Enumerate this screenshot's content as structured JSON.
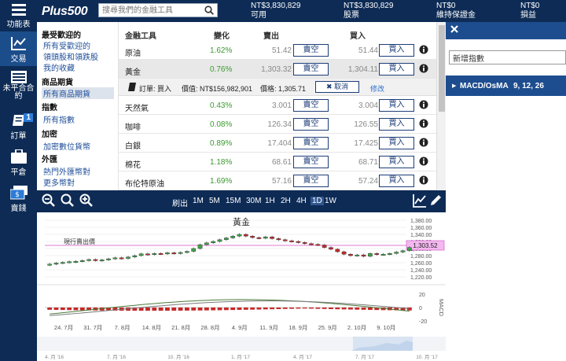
{
  "nav": {
    "items": [
      {
        "label": "功能表",
        "icon": "hamburger-menu-icon"
      },
      {
        "label": "交易",
        "icon": "trade-chart-icon"
      },
      {
        "label": "未平合合約",
        "icon": "positions-list-icon"
      },
      {
        "label": "訂單",
        "icon": "orders-notebook-icon",
        "badge": "1"
      },
      {
        "label": "平倉",
        "icon": "briefcase-icon"
      },
      {
        "label": "賣錢",
        "icon": "funds-money-icon"
      }
    ]
  },
  "header": {
    "logo": "Plus500",
    "search_placeholder": "搜尋我們的金融工具",
    "stats": [
      {
        "value": "NT$3,830,829",
        "label": "可用"
      },
      {
        "value": "NT$3,830,829",
        "label": "股票"
      },
      {
        "value": "NT$0",
        "label": "維持保證金"
      },
      {
        "value": "NT$0",
        "label": "損益"
      }
    ]
  },
  "sidebar": {
    "groups": [
      {
        "heading": "最受歡迎的",
        "items": [
          "所有受歡迎的",
          "領頭股和領跌股",
          "我的收藏"
        ]
      },
      {
        "heading": "商品期貨",
        "items": [
          "所有商品期貨"
        ]
      },
      {
        "heading": "指數",
        "items": [
          "所有指數"
        ]
      },
      {
        "heading": "加密",
        "items": [
          "加密數位貨幣"
        ]
      },
      {
        "heading": "外匯",
        "items": [
          "熱門外匯幣對",
          "更多幣對"
        ]
      }
    ],
    "selected": "所有商品期貨"
  },
  "table": {
    "headers": {
      "instrument": "金融工具",
      "change": "變化",
      "sell": "賣出",
      "buy": "買入"
    },
    "sell_label": "賣空",
    "buy_label": "買入",
    "rows": [
      {
        "name": "原油",
        "change": "1.62%",
        "sell": "51.42",
        "buy": "51.44"
      },
      {
        "name": "黃金",
        "change": "0.76%",
        "sell": "1,303.32",
        "buy": "1,304.11"
      },
      {
        "name": "天然氣",
        "change": "0.43%",
        "sell": "3.001",
        "buy": "3.004"
      },
      {
        "name": "咖啡",
        "change": "0.08%",
        "sell": "126.34",
        "buy": "126.55"
      },
      {
        "name": "白銀",
        "change": "0.89%",
        "sell": "17.404",
        "buy": "17.425"
      },
      {
        "name": "棉花",
        "change": "1.18%",
        "sell": "68.61",
        "buy": "68.71"
      },
      {
        "name": "布伦特原油",
        "change": "1.69%",
        "sell": "57.16",
        "buy": "57.24"
      }
    ],
    "order": {
      "label": "訂單: 買入",
      "value": "價值: NT$156,982,901",
      "price": "價格: 1,305.71",
      "cancel": "取消",
      "modify": "修改"
    }
  },
  "right_panel": {
    "indicator_input": "新增指數",
    "indicator_name": "MACD/OsMA",
    "indicator_params": "9, 12, 26"
  },
  "chart_toolbar": {
    "prefix": "刷出",
    "timeframes": [
      "1M",
      "5M",
      "15M",
      "30M",
      "1H",
      "2H",
      "4H",
      "1D",
      "1W"
    ],
    "selected": "1D"
  },
  "chart_data": {
    "type": "candlestick",
    "title": "黃金",
    "price_line_label": "現行賣出價",
    "current_price": "1,303.52",
    "y_ticks": [
      "1,380.00",
      "1,360.00",
      "1,340.00",
      "1,320.00",
      "1,300.00",
      "1,280.00",
      "1,260.00",
      "1,240.00",
      "1,220.00"
    ],
    "ylim": [
      1220,
      1380
    ],
    "x_ticks": [
      "24. 7月",
      "31. 7月",
      "7. 8月",
      "14. 8月",
      "21. 8月",
      "28. 8月",
      "4. 9月",
      "11. 9月",
      "18. 9月",
      "25. 9月",
      "2. 10月",
      "9. 10月"
    ],
    "candles": [
      [
        1253,
        1256
      ],
      [
        1256,
        1259
      ],
      [
        1259,
        1261
      ],
      [
        1261,
        1263
      ],
      [
        1262,
        1264
      ],
      [
        1264,
        1266
      ],
      [
        1266,
        1269
      ],
      [
        1269,
        1266
      ],
      [
        1266,
        1268
      ],
      [
        1268,
        1271
      ],
      [
        1271,
        1274
      ],
      [
        1274,
        1272
      ],
      [
        1272,
        1276
      ],
      [
        1276,
        1280
      ],
      [
        1280,
        1285
      ],
      [
        1285,
        1283
      ],
      [
        1283,
        1286
      ],
      [
        1286,
        1285
      ],
      [
        1285,
        1288
      ],
      [
        1288,
        1286
      ],
      [
        1286,
        1289
      ],
      [
        1289,
        1292
      ],
      [
        1292,
        1300
      ],
      [
        1300,
        1311
      ],
      [
        1311,
        1316
      ],
      [
        1316,
        1320
      ],
      [
        1320,
        1325
      ],
      [
        1325,
        1330
      ],
      [
        1330,
        1335
      ],
      [
        1335,
        1340
      ],
      [
        1340,
        1335
      ],
      [
        1335,
        1331
      ],
      [
        1331,
        1329
      ],
      [
        1329,
        1333
      ],
      [
        1333,
        1328
      ],
      [
        1328,
        1325
      ],
      [
        1325,
        1322
      ],
      [
        1322,
        1320
      ],
      [
        1320,
        1317
      ],
      [
        1317,
        1314
      ],
      [
        1314,
        1312
      ],
      [
        1312,
        1310
      ],
      [
        1310,
        1303
      ],
      [
        1303,
        1298
      ],
      [
        1298,
        1291
      ],
      [
        1291,
        1284
      ],
      [
        1284,
        1280
      ],
      [
        1280,
        1282
      ],
      [
        1282,
        1278
      ],
      [
        1278,
        1286
      ],
      [
        1286,
        1283
      ],
      [
        1283,
        1284
      ],
      [
        1284,
        1286
      ],
      [
        1286,
        1290
      ],
      [
        1290,
        1294
      ],
      [
        1294,
        1303
      ]
    ],
    "macd": {
      "label": "MACD",
      "ticks": [
        "20",
        "0",
        "-20"
      ],
      "ylim": [
        -25,
        25
      ]
    },
    "navigator_ticks": [
      "4. 月 '16",
      "7. 月 '16",
      "10. 月 '16",
      "1. 月 '17",
      "4. 月 '17",
      "7. 月 '17",
      "10. 月 '17"
    ]
  },
  "colors": {
    "nav_bg": "#0d2b55",
    "accent": "#1d4d8f",
    "up": "#3ea34a",
    "down": "#c62828",
    "price_line": "#e07ad6"
  }
}
